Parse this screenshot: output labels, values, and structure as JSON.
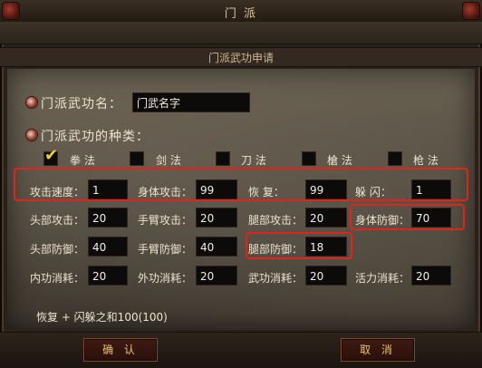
{
  "window": {
    "title": "门 派"
  },
  "dialog": {
    "subtitle": "门派武功申请"
  },
  "form": {
    "name_label": "门派武功名：",
    "name_value": "门武名字",
    "type_label": "门派武功的种类：",
    "types": [
      {
        "label": "拳 法",
        "checked": true
      },
      {
        "label": "剑 法",
        "checked": false
      },
      {
        "label": "刀 法",
        "checked": false
      },
      {
        "label": "槍 法",
        "checked": false
      },
      {
        "label": "枪 法",
        "checked": false
      }
    ],
    "stats": {
      "attack_speed": {
        "label": "攻击速度：",
        "value": "1"
      },
      "body_attack": {
        "label": "身体攻击：",
        "value": "99"
      },
      "recover": {
        "label": "恢    复：",
        "value": "99"
      },
      "dodge": {
        "label": "躲    闪：",
        "value": "1"
      },
      "head_attack": {
        "label": "头部攻击：",
        "value": "20"
      },
      "arm_attack": {
        "label": "手臂攻击：",
        "value": "20"
      },
      "leg_attack": {
        "label": "腿部攻击：",
        "value": "20"
      },
      "body_defense": {
        "label": "身体防御：",
        "value": "70"
      },
      "head_defense": {
        "label": "头部防御：",
        "value": "40"
      },
      "arm_defense": {
        "label": "手臂防御：",
        "value": "40"
      },
      "leg_defense": {
        "label": "腿部防御：",
        "value": "18"
      },
      "inner_consume": {
        "label": "内功消耗：",
        "value": "20"
      },
      "outer_consume": {
        "label": "外功消耗：",
        "value": "20"
      },
      "martial_consume": {
        "label": "武功消耗：",
        "value": "20"
      },
      "vitality_consume": {
        "label": "活力消耗：",
        "value": "20"
      }
    },
    "hint": "恢复 + 闪躲之和100(100)"
  },
  "buttons": {
    "confirm": "确 认",
    "cancel": "取 消"
  },
  "colors": {
    "highlight": "#e0231b",
    "checkmark": "#f2d232"
  }
}
